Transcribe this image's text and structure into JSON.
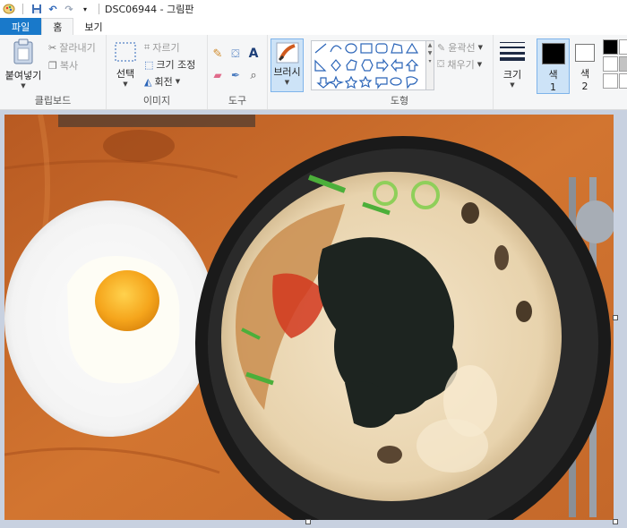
{
  "window": {
    "title": "DSC06944 - 그림판"
  },
  "tabs": {
    "file": "파일",
    "home": "홈",
    "view": "보기"
  },
  "clipboard": {
    "paste": "붙여넣기",
    "cut": "잘라내기",
    "copy": "복사",
    "label": "클립보드"
  },
  "image": {
    "select": "선택",
    "crop": "자르기",
    "resize": "크기 조정",
    "rotate": "회전",
    "label": "이미지"
  },
  "tools": {
    "label": "도구"
  },
  "brushes": {
    "label": "브러시"
  },
  "shapes": {
    "outline": "윤곽선",
    "fill": "채우기",
    "label": "도형"
  },
  "size": {
    "label": "크기"
  },
  "colors": {
    "color1_label": "색",
    "color1_num": "1",
    "color2_label": "색",
    "color2_num": "2",
    "color1": "#000000",
    "color2": "#ffffff",
    "palette": [
      "#000000",
      "#ffffff",
      "#7f7f7f",
      "#c3c3c3",
      "#ffffff",
      "#ffffff"
    ]
  },
  "accent": "#1979ca"
}
